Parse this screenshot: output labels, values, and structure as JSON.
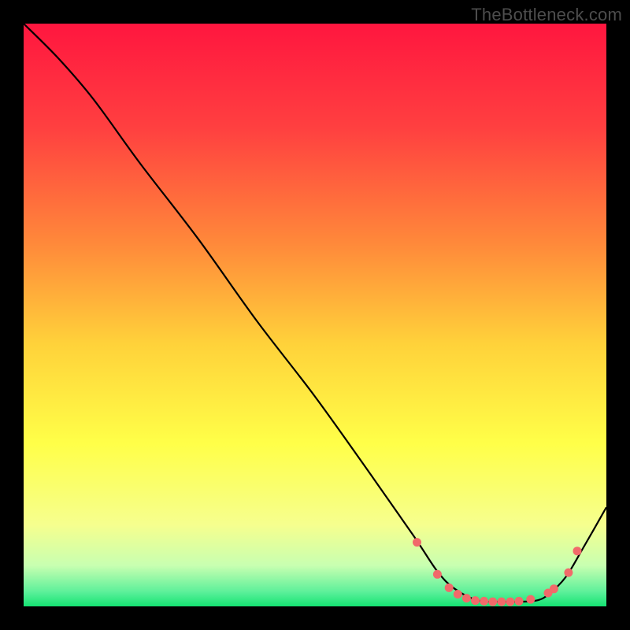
{
  "watermark": "TheBottleneck.com",
  "chart_data": {
    "type": "line",
    "title": "",
    "xlabel": "",
    "ylabel": "",
    "xlim": [
      0,
      100
    ],
    "ylim": [
      0,
      100
    ],
    "gradient_stops": [
      {
        "offset": 0,
        "color": "#ff163f"
      },
      {
        "offset": 18,
        "color": "#ff4040"
      },
      {
        "offset": 38,
        "color": "#ff8a3a"
      },
      {
        "offset": 55,
        "color": "#ffd23a"
      },
      {
        "offset": 72,
        "color": "#ffff48"
      },
      {
        "offset": 86,
        "color": "#f6ff8e"
      },
      {
        "offset": 93,
        "color": "#c8ffb1"
      },
      {
        "offset": 97.5,
        "color": "#5df09a"
      },
      {
        "offset": 100,
        "color": "#14e373"
      }
    ],
    "series": [
      {
        "name": "bottleneck-curve",
        "x": [
          0,
          6,
          12,
          20,
          30,
          40,
          50,
          60,
          67,
          71,
          74,
          78,
          82,
          85,
          88,
          90,
          93,
          96,
          100
        ],
        "y": [
          100,
          94,
          87,
          76,
          63,
          49,
          36,
          22,
          12,
          6,
          3,
          1,
          0.8,
          0.8,
          1,
          2,
          5,
          10,
          17
        ]
      }
    ],
    "markers": {
      "name": "highlight-points",
      "color": "#f16a6a",
      "x": [
        67.5,
        71,
        73,
        74.5,
        76,
        77.5,
        79,
        80.5,
        82,
        83.5,
        85,
        87,
        90,
        91,
        93.5,
        95
      ],
      "y": [
        11,
        5.5,
        3.2,
        2.1,
        1.4,
        1.0,
        0.9,
        0.8,
        0.8,
        0.8,
        0.9,
        1.2,
        2.3,
        3.0,
        5.8,
        9.5
      ]
    }
  }
}
